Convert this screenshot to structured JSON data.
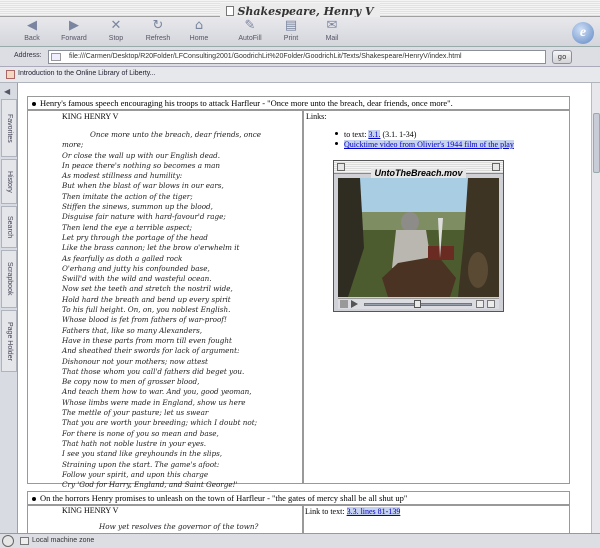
{
  "window": {
    "title": "Shakespeare, Henry V"
  },
  "toolbar": {
    "buttons": [
      {
        "label": "Back",
        "icon": "back-arrow-icon",
        "glyph": "◀"
      },
      {
        "label": "Forward",
        "icon": "forward-arrow-icon",
        "glyph": "▶"
      },
      {
        "label": "Stop",
        "icon": "stop-icon",
        "glyph": "✕"
      },
      {
        "label": "Refresh",
        "icon": "refresh-icon",
        "glyph": "↻"
      },
      {
        "label": "Home",
        "icon": "home-icon",
        "glyph": "⌂"
      },
      {
        "label": "AutoFill",
        "icon": "autofill-icon",
        "glyph": "✎"
      },
      {
        "label": "Print",
        "icon": "print-icon",
        "glyph": "▤"
      },
      {
        "label": "Mail",
        "icon": "mail-icon",
        "glyph": "✉"
      }
    ],
    "logo": "e"
  },
  "address": {
    "label": "Address:",
    "url": "file:///Carmen/Desktop/R20Folder/LFConsulting2001/GoodrichLit%20Folder/GoodrichLit/Texts/Shakespeare/HenryV/index.html",
    "go_label": "go"
  },
  "favorites": {
    "item": "Introduction to the Online Library of Liberty..."
  },
  "explorer_tabs": [
    "Favorites",
    "History",
    "Search",
    "Scrapbook",
    "Page Holder"
  ],
  "section1": {
    "heading": "Henry's famous speech encouraging his troops to attack Harfleur - \"Once more unto the breach, dear friends, once more\".",
    "speaker": "KING HENRY V",
    "lines": [
      "Once more unto the breach, dear friends, once",
      "more;",
      "Or close the wall up with our English dead.",
      "In peace there's nothing so becomes a man",
      "As modest stillness and humility:",
      "But when the blast of war blows in our ears,",
      "Then imitate the action of the tiger;",
      "Stiffen the sinews, summon up the blood,",
      "Disguise fair nature with hard-favour'd rage;",
      "Then lend the eye a terrible aspect;",
      "Let pry through the portage of the head",
      "Like the brass cannon; let the brow o'erwhelm it",
      "As fearfully as doth a galled rock",
      "O'erhang and jutty his confounded base,",
      "Swill'd with the wild and wasteful ocean.",
      "Now set the teeth and stretch the nostril wide,",
      "Hold hard the breath and bend up every spirit",
      "To his full height. On, on, you noblest English.",
      "Whose blood is fet from fathers of war-proof!",
      "Fathers that, like so many Alexanders,",
      "Have in these parts from morn till even fought",
      "And sheathed their swords for lack of argument:",
      "Dishonour not your mothers; now attest",
      "That those whom you call'd fathers did beget you.",
      "Be copy now to men of grosser blood,",
      "And teach them how to war. And you, good yeoman,",
      "Whose limbs were made in England, show us here",
      "The mettle of your pasture; let us swear",
      "That you are worth your breeding; which I doubt not;",
      "For there is none of you so mean and base,",
      "That hath not noble lustre in your eyes.",
      "I see you stand like greyhounds in the slips,",
      "Straining upon the start. The game's afoot:",
      "Follow your spirit, and upon this charge",
      "Cry 'God for Harry, England, and Saint George!'"
    ],
    "links_title": "Links:",
    "link_items": [
      {
        "prefix": "to text: ",
        "link": "3.1.",
        "suffix": " (3.1. 1-34)"
      },
      {
        "prefix": "",
        "link": "Quicktime video from Olivier's 1944 film of the play",
        "suffix": ""
      }
    ]
  },
  "movie": {
    "title": "UntoTheBreach.mov",
    "playhead_fraction": 0.5
  },
  "section2": {
    "heading": "On the horrors Henry promises to unleash on the town of Harfleur - \"the gates of mercy shall be all shut up\"",
    "speaker": "KING HENRY V",
    "first_line": "How yet resolves the governor of the town?",
    "link_prefix": "Link to text: ",
    "link": "3.3. lines 81-139"
  },
  "status": {
    "zone": "Local machine zone"
  }
}
